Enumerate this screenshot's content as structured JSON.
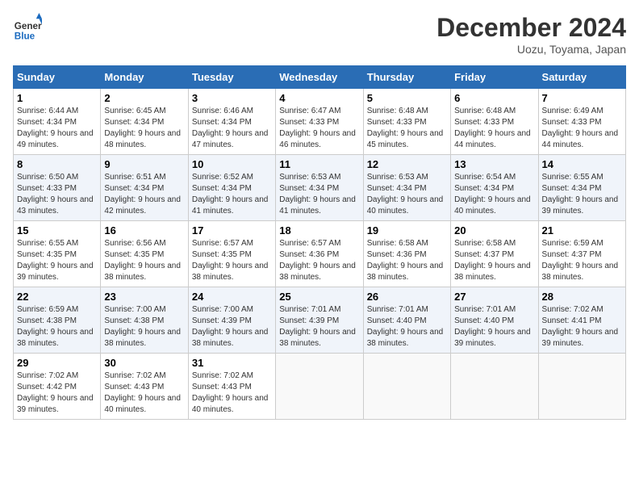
{
  "header": {
    "logo_text_general": "General",
    "logo_text_blue": "Blue",
    "month_title": "December 2024",
    "location": "Uozu, Toyama, Japan"
  },
  "days_of_week": [
    "Sunday",
    "Monday",
    "Tuesday",
    "Wednesday",
    "Thursday",
    "Friday",
    "Saturday"
  ],
  "weeks": [
    [
      {
        "num": "1",
        "sunrise": "6:44 AM",
        "sunset": "4:34 PM",
        "daylight": "9 hours and 49 minutes."
      },
      {
        "num": "2",
        "sunrise": "6:45 AM",
        "sunset": "4:34 PM",
        "daylight": "9 hours and 48 minutes."
      },
      {
        "num": "3",
        "sunrise": "6:46 AM",
        "sunset": "4:34 PM",
        "daylight": "9 hours and 47 minutes."
      },
      {
        "num": "4",
        "sunrise": "6:47 AM",
        "sunset": "4:33 PM",
        "daylight": "9 hours and 46 minutes."
      },
      {
        "num": "5",
        "sunrise": "6:48 AM",
        "sunset": "4:33 PM",
        "daylight": "9 hours and 45 minutes."
      },
      {
        "num": "6",
        "sunrise": "6:48 AM",
        "sunset": "4:33 PM",
        "daylight": "9 hours and 44 minutes."
      },
      {
        "num": "7",
        "sunrise": "6:49 AM",
        "sunset": "4:33 PM",
        "daylight": "9 hours and 44 minutes."
      }
    ],
    [
      {
        "num": "8",
        "sunrise": "6:50 AM",
        "sunset": "4:33 PM",
        "daylight": "9 hours and 43 minutes."
      },
      {
        "num": "9",
        "sunrise": "6:51 AM",
        "sunset": "4:34 PM",
        "daylight": "9 hours and 42 minutes."
      },
      {
        "num": "10",
        "sunrise": "6:52 AM",
        "sunset": "4:34 PM",
        "daylight": "9 hours and 41 minutes."
      },
      {
        "num": "11",
        "sunrise": "6:53 AM",
        "sunset": "4:34 PM",
        "daylight": "9 hours and 41 minutes."
      },
      {
        "num": "12",
        "sunrise": "6:53 AM",
        "sunset": "4:34 PM",
        "daylight": "9 hours and 40 minutes."
      },
      {
        "num": "13",
        "sunrise": "6:54 AM",
        "sunset": "4:34 PM",
        "daylight": "9 hours and 40 minutes."
      },
      {
        "num": "14",
        "sunrise": "6:55 AM",
        "sunset": "4:34 PM",
        "daylight": "9 hours and 39 minutes."
      }
    ],
    [
      {
        "num": "15",
        "sunrise": "6:55 AM",
        "sunset": "4:35 PM",
        "daylight": "9 hours and 39 minutes."
      },
      {
        "num": "16",
        "sunrise": "6:56 AM",
        "sunset": "4:35 PM",
        "daylight": "9 hours and 38 minutes."
      },
      {
        "num": "17",
        "sunrise": "6:57 AM",
        "sunset": "4:35 PM",
        "daylight": "9 hours and 38 minutes."
      },
      {
        "num": "18",
        "sunrise": "6:57 AM",
        "sunset": "4:36 PM",
        "daylight": "9 hours and 38 minutes."
      },
      {
        "num": "19",
        "sunrise": "6:58 AM",
        "sunset": "4:36 PM",
        "daylight": "9 hours and 38 minutes."
      },
      {
        "num": "20",
        "sunrise": "6:58 AM",
        "sunset": "4:37 PM",
        "daylight": "9 hours and 38 minutes."
      },
      {
        "num": "21",
        "sunrise": "6:59 AM",
        "sunset": "4:37 PM",
        "daylight": "9 hours and 38 minutes."
      }
    ],
    [
      {
        "num": "22",
        "sunrise": "6:59 AM",
        "sunset": "4:38 PM",
        "daylight": "9 hours and 38 minutes."
      },
      {
        "num": "23",
        "sunrise": "7:00 AM",
        "sunset": "4:38 PM",
        "daylight": "9 hours and 38 minutes."
      },
      {
        "num": "24",
        "sunrise": "7:00 AM",
        "sunset": "4:39 PM",
        "daylight": "9 hours and 38 minutes."
      },
      {
        "num": "25",
        "sunrise": "7:01 AM",
        "sunset": "4:39 PM",
        "daylight": "9 hours and 38 minutes."
      },
      {
        "num": "26",
        "sunrise": "7:01 AM",
        "sunset": "4:40 PM",
        "daylight": "9 hours and 38 minutes."
      },
      {
        "num": "27",
        "sunrise": "7:01 AM",
        "sunset": "4:40 PM",
        "daylight": "9 hours and 39 minutes."
      },
      {
        "num": "28",
        "sunrise": "7:02 AM",
        "sunset": "4:41 PM",
        "daylight": "9 hours and 39 minutes."
      }
    ],
    [
      {
        "num": "29",
        "sunrise": "7:02 AM",
        "sunset": "4:42 PM",
        "daylight": "9 hours and 39 minutes."
      },
      {
        "num": "30",
        "sunrise": "7:02 AM",
        "sunset": "4:43 PM",
        "daylight": "9 hours and 40 minutes."
      },
      {
        "num": "31",
        "sunrise": "7:02 AM",
        "sunset": "4:43 PM",
        "daylight": "9 hours and 40 minutes."
      },
      null,
      null,
      null,
      null
    ]
  ]
}
